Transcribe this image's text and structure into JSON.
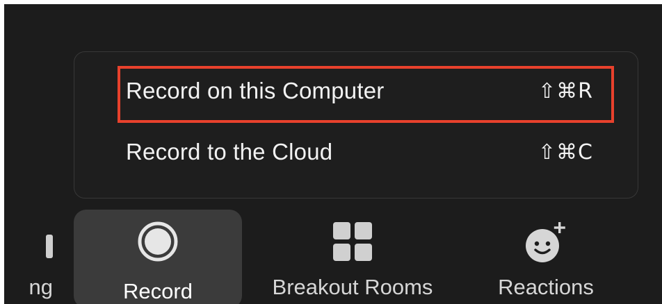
{
  "menu": {
    "items": [
      {
        "label": "Record on this Computer",
        "shortcut": "⇧⌘R"
      },
      {
        "label": "Record to the Cloud",
        "shortcut": "⇧⌘C"
      }
    ],
    "highlight_color": "#e8412c"
  },
  "toolbar": {
    "partial_label": "ng",
    "record_label": "Record",
    "breakout_label": "Breakout Rooms",
    "reactions_label": "Reactions",
    "icons": {
      "record": "record-icon",
      "breakout": "breakout-rooms-icon",
      "reactions": "reactions-icon"
    }
  }
}
